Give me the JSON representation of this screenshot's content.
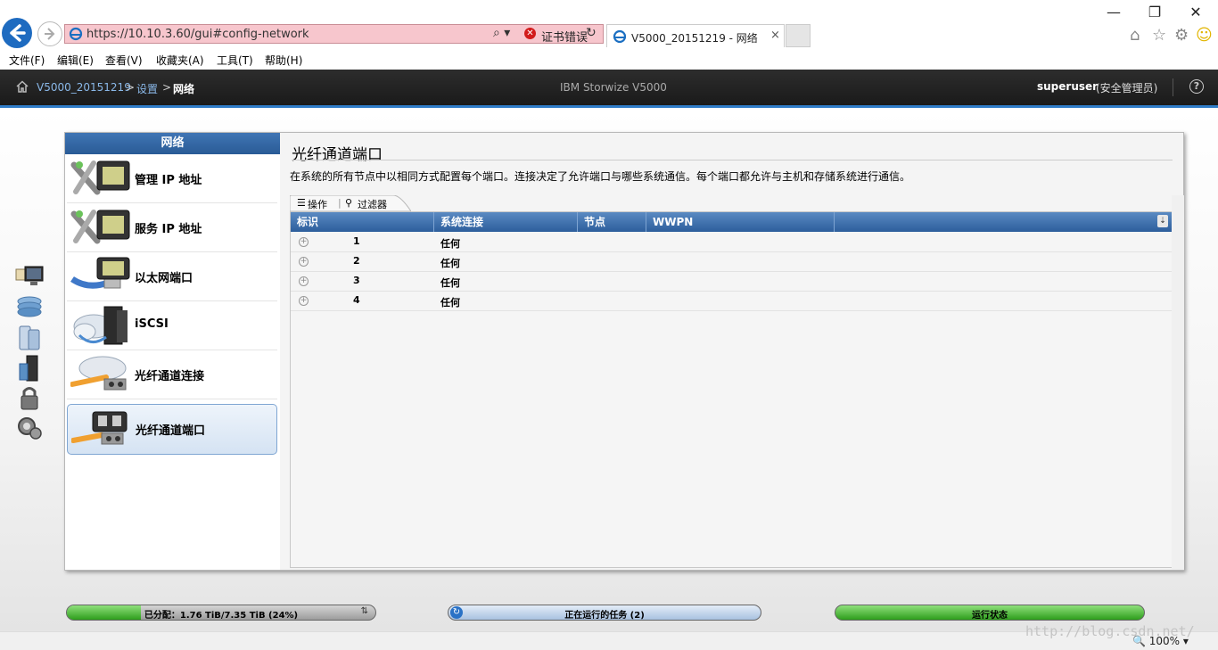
{
  "browser": {
    "url": "https://10.10.3.60/gui#config-network",
    "cert_error": "证书错误",
    "tab_title": "V5000_20151219 - 网络",
    "tab_close": "×",
    "window": {
      "minimize": "—",
      "maximize": "❐",
      "close": "✕"
    }
  },
  "menubar": [
    "文件(F)",
    "编辑(E)",
    "查看(V)",
    "收藏夹(A)",
    "工具(T)",
    "帮助(H)"
  ],
  "header": {
    "breadcrumb": [
      "V5000_20151219",
      ">",
      "设置",
      ">",
      "网络"
    ],
    "product": "IBM Storwize V5000",
    "user": "superuser",
    "role": "(安全管理员)",
    "help": "?"
  },
  "nav": {
    "title": "网络",
    "items": [
      {
        "label": "管理 IP 地址",
        "icon": "management-ip-icon"
      },
      {
        "label": "服务 IP 地址",
        "icon": "service-ip-icon"
      },
      {
        "label": "以太网端口",
        "icon": "ethernet-port-icon"
      },
      {
        "label": "iSCSI",
        "icon": "iscsi-icon"
      },
      {
        "label": "光纤通道连接",
        "icon": "fc-connectivity-icon"
      },
      {
        "label": "光纤通道端口",
        "icon": "fc-port-icon",
        "selected": true
      }
    ]
  },
  "content": {
    "title": "光纤通道端口",
    "description": "在系统的所有节点中以相同方式配置每个端口。连接决定了允许端口与哪些系统通信。每个端口都允许与主机和存储系统进行通信。",
    "actions_label": "操作",
    "filter_label": "过滤器"
  },
  "table": {
    "columns": [
      "标识",
      "系统连接",
      "节点",
      "WWPN"
    ],
    "rows": [
      {
        "id": "1",
        "connection": "任何"
      },
      {
        "id": "2",
        "connection": "任何"
      },
      {
        "id": "3",
        "connection": "任何"
      },
      {
        "id": "4",
        "connection": "任何"
      }
    ]
  },
  "status": {
    "capacity_label": "已分配：1.76 TiB/7.35 TiB (24%)",
    "capacity_fraction": 0.24,
    "tasks_label": "正在运行的任务 (2)",
    "health_label": "运行状态"
  },
  "browser_status": {
    "zoom": "100%",
    "watermark": "http://blog.csdn.net/"
  },
  "colors": {
    "accent": "#2f7cc8",
    "nav_header": "#2a5b96",
    "health": "#2e9e1c",
    "cert_error_bg": "#f7c6cd"
  }
}
